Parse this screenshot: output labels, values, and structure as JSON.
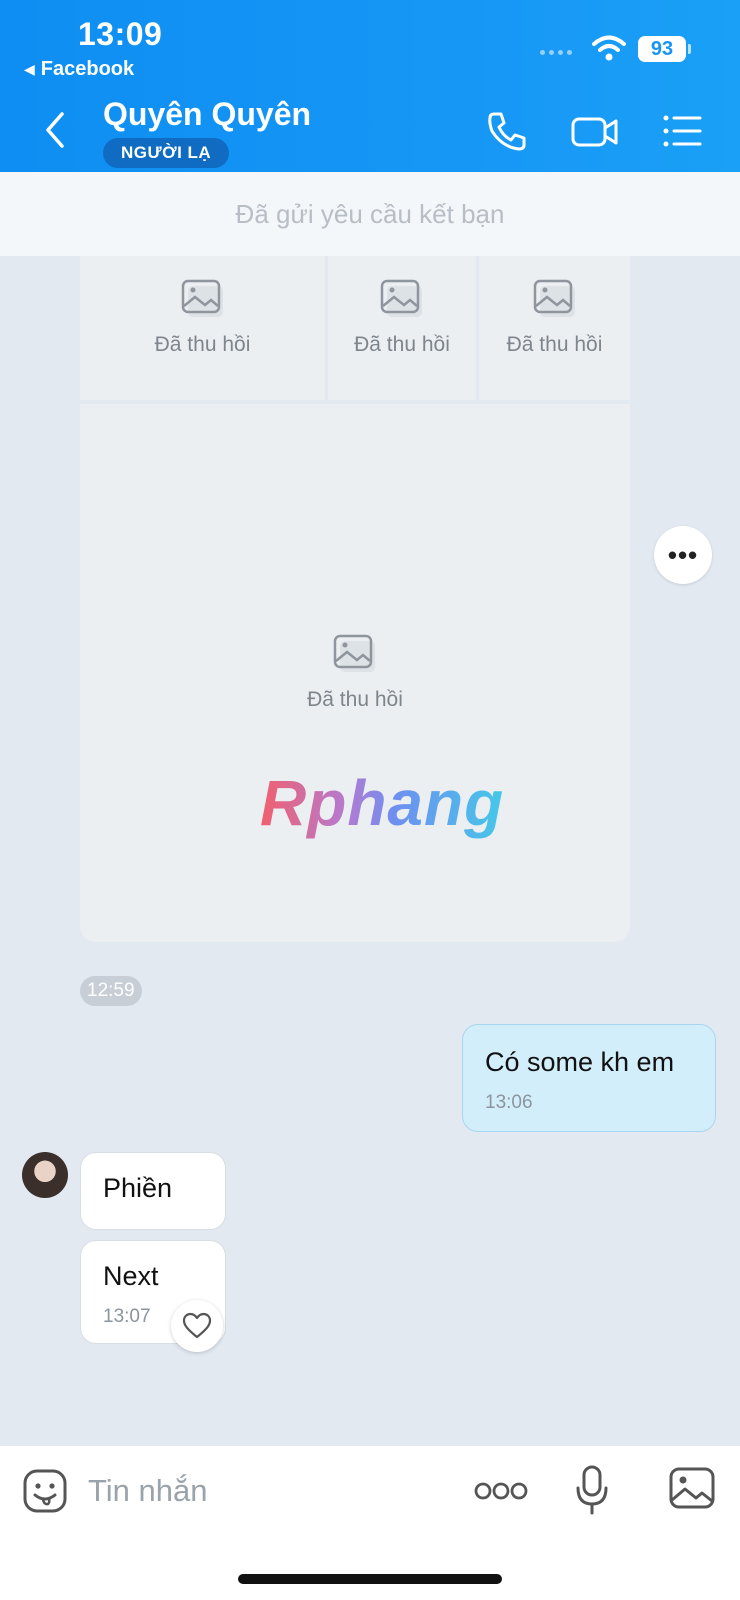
{
  "status_bar": {
    "time": "13:09",
    "back_app": "Facebook",
    "battery": "93"
  },
  "header": {
    "contact_name": "Quyên Quyên",
    "badge": "NGƯỜI LẠ",
    "icons": [
      "back-arrow-icon",
      "phone-icon",
      "video-call-icon",
      "menu-list-icon"
    ],
    "accent_color": "#1596f5"
  },
  "friend_request": {
    "text": "Đã gửi yêu cầu kết bạn"
  },
  "media_group": {
    "items": [
      {
        "label": "Đã thu hồi"
      },
      {
        "label": "Đã thu hồi"
      },
      {
        "label": "Đã thu hồi"
      },
      {
        "label": "Đã thu hồi"
      }
    ],
    "time": "12:59"
  },
  "watermark": "Rphang",
  "messages": [
    {
      "direction": "out",
      "text": "Có some kh em",
      "time": "13:06"
    },
    {
      "direction": "in",
      "text": "Phiền"
    },
    {
      "direction": "in",
      "text": "Next",
      "time": "13:07"
    }
  ],
  "composer": {
    "placeholder": "Tin nhắn"
  }
}
